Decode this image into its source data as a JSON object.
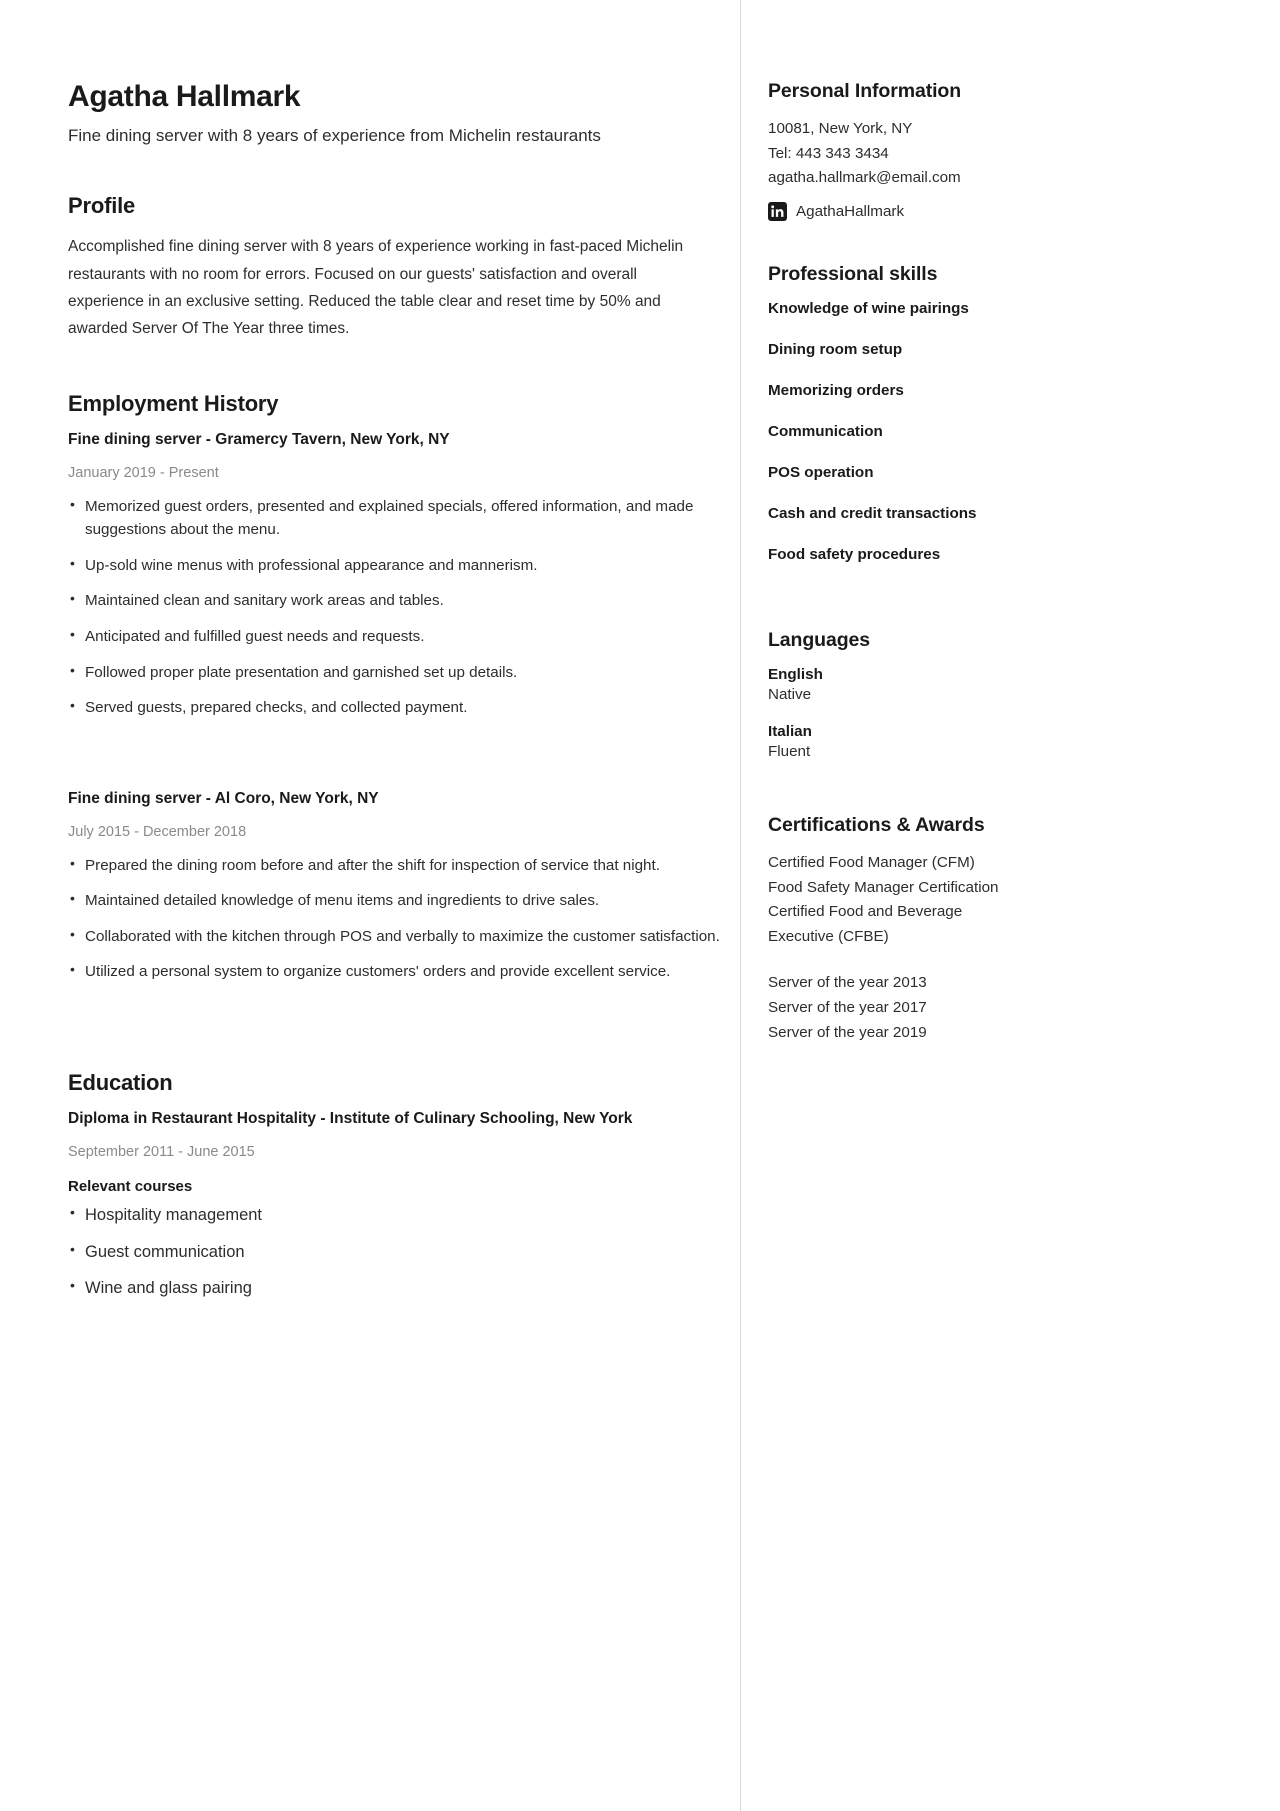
{
  "header": {
    "name": "Agatha Hallmark",
    "tagline": "Fine dining server with 8 years of experience from Michelin restaurants"
  },
  "profile": {
    "title": "Profile",
    "text": "Accomplished fine dining server with 8 years of experience working in fast-paced Michelin restaurants with no room for errors. Focused on our guests' satisfaction and overall experience in an exclusive setting. Reduced the table clear and reset time by 50% and awarded Server Of The Year three times."
  },
  "employment": {
    "title": "Employment History",
    "jobs": [
      {
        "title": "Fine dining server - Gramercy Tavern, New York, NY",
        "dates": "January 2019 - Present",
        "bullets": [
          "Memorized guest orders, presented and explained specials, offered information, and made suggestions about the menu.",
          "Up-sold wine menus with professional appearance and mannerism.",
          "Maintained clean and sanitary work areas and tables.",
          "Anticipated and fulfilled guest needs and requests.",
          "Followed proper plate presentation and garnished set up details.",
          "Served guests, prepared checks, and collected payment."
        ]
      },
      {
        "title": "Fine dining server - Al Coro, New York, NY",
        "dates": "July 2015 - December 2018",
        "bullets": [
          "Prepared the dining room before and after the shift for inspection of service that night.",
          "Maintained detailed knowledge of menu items and ingredients to drive sales.",
          "Collaborated with the kitchen through POS and verbally to maximize the customer satisfaction.",
          "Utilized a personal system to organize customers' orders and provide excellent service."
        ]
      }
    ]
  },
  "education": {
    "title": "Education",
    "degree": "Diploma in Restaurant Hospitality - Institute of Culinary Schooling, New York",
    "dates": "September 2011 - June 2015",
    "courses_label": "Relevant courses",
    "courses": [
      "Hospitality management",
      "Guest communication",
      "Wine and glass pairing"
    ]
  },
  "sidebar": {
    "personal": {
      "title": "Personal Information",
      "address": "10081, New York, NY",
      "phone": "Tel: 443 343 3434",
      "email": "agatha.hallmark@email.com",
      "linkedin_icon": "linkedin-icon",
      "linkedin_handle": "AgathaHallmark"
    },
    "skills": {
      "title": "Professional skills",
      "items": [
        "Knowledge of wine pairings",
        "Dining room setup",
        "Memorizing orders",
        "Communication",
        "POS operation",
        "Cash and credit transactions",
        "Food safety procedures"
      ]
    },
    "languages": {
      "title": "Languages",
      "items": [
        {
          "name": "English",
          "level": "Native"
        },
        {
          "name": "Italian",
          "level": "Fluent"
        }
      ]
    },
    "certifications": {
      "title": "Certifications & Awards",
      "certs": [
        "Certified Food Manager (CFM)",
        "Food Safety Manager Certification",
        "Certified Food and Beverage",
        "Executive (CFBE)"
      ],
      "awards": [
        "Server of the year 2013",
        "Server of the year 2017",
        "Server of the year 2019"
      ]
    }
  },
  "colors": {
    "text": "#2d2d2d",
    "heading": "#1a1a1a",
    "muted": "#8a8a8a",
    "divider": "#d8d8d8"
  }
}
